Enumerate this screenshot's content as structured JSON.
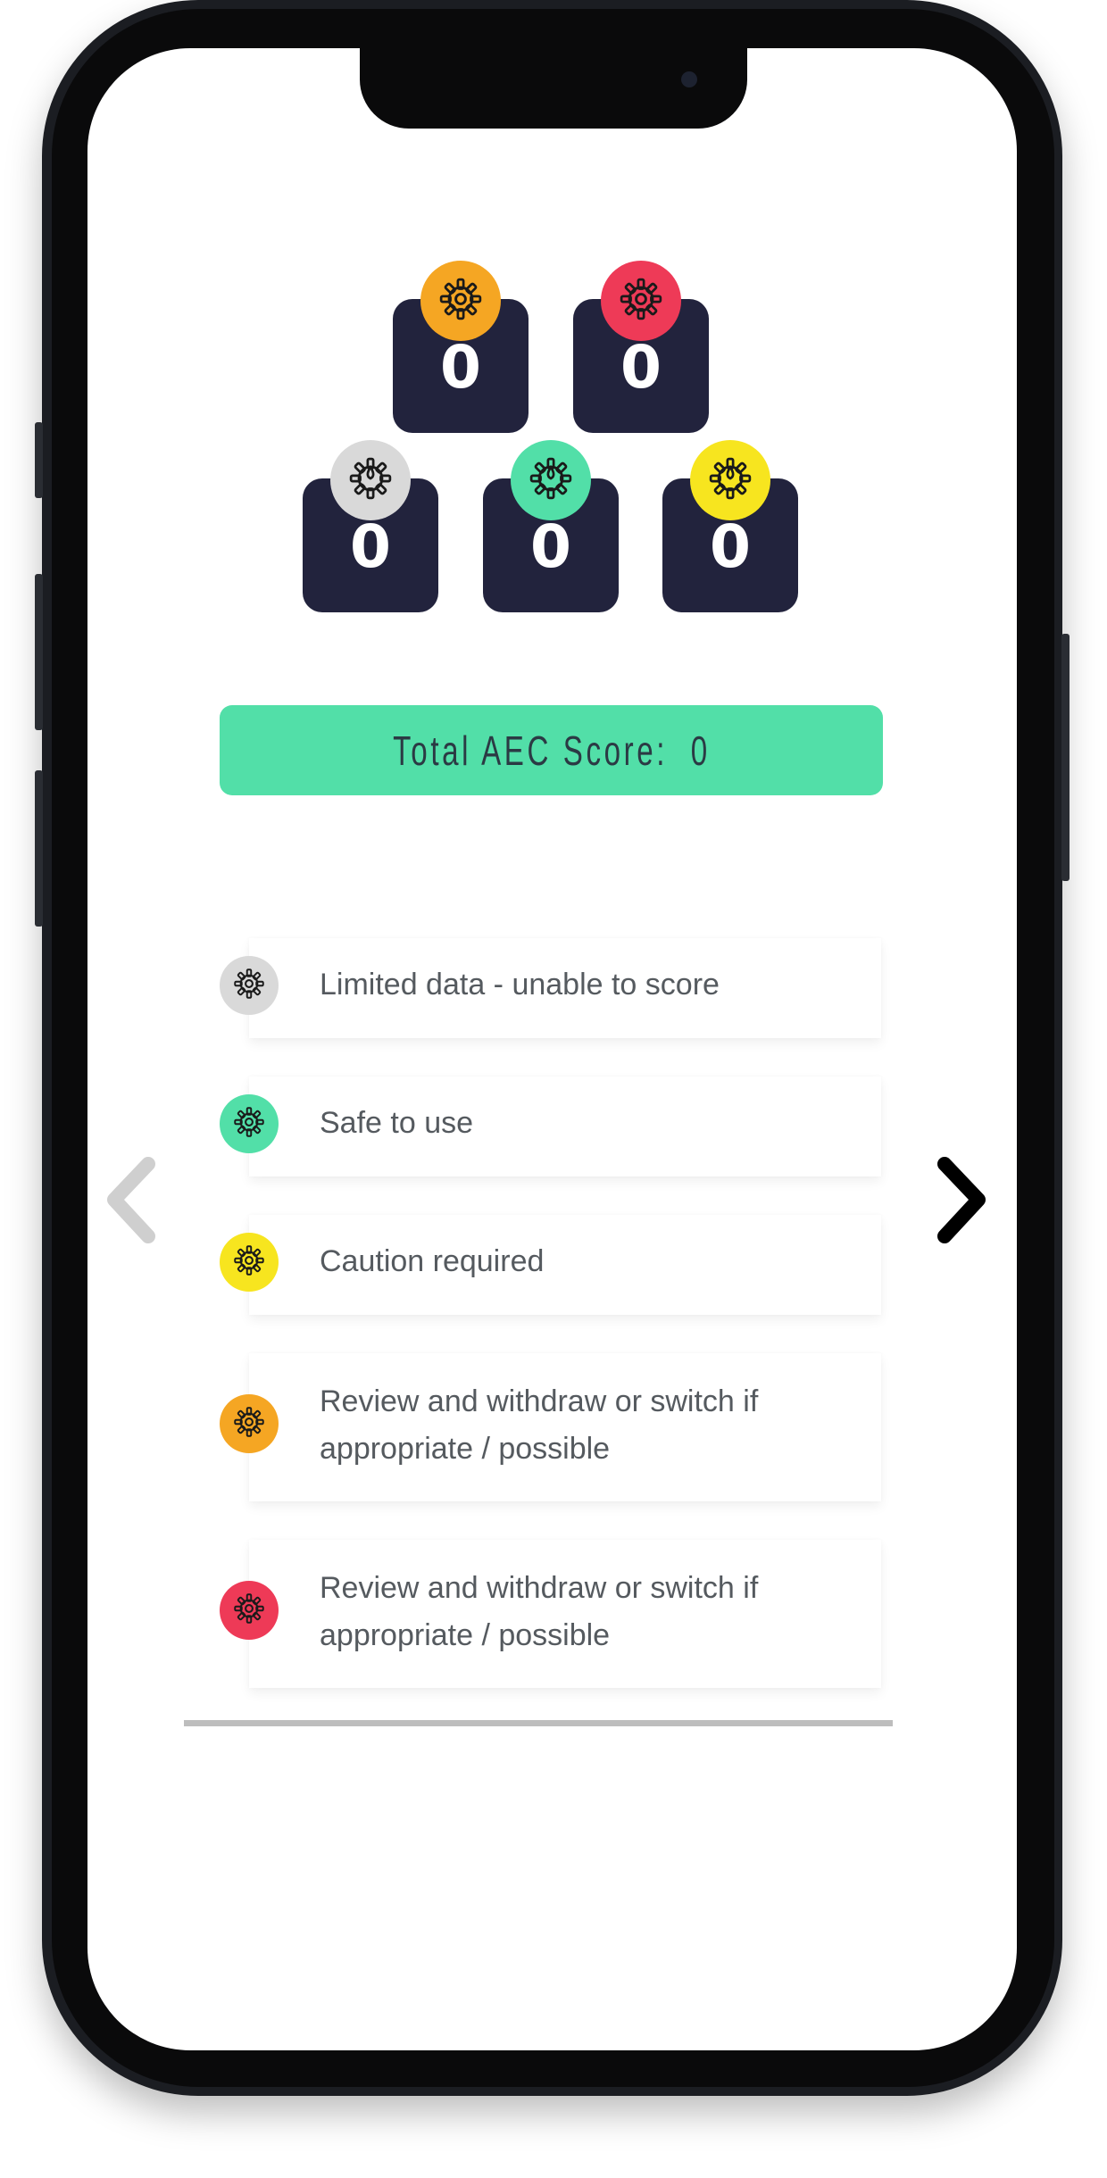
{
  "scores": {
    "top": [
      {
        "value": "0",
        "color": "#f5a623",
        "icon": "gear-icon"
      },
      {
        "value": "0",
        "color": "#ee3a57",
        "icon": "gear-icon"
      }
    ],
    "bottom": [
      {
        "value": "0",
        "color": "#d9d9d9",
        "icon": "gear-drop-icon"
      },
      {
        "value": "0",
        "color": "#52dfa8",
        "icon": "gear-drop-icon"
      },
      {
        "value": "0",
        "color": "#f7e51f",
        "icon": "gear-drop-icon"
      }
    ]
  },
  "total": {
    "label": "Total AEC Score:  0",
    "color": "#52dfa8"
  },
  "legend": [
    {
      "label": "Limited data - unable to score",
      "color": "#d9d9d9"
    },
    {
      "label": "Safe to use",
      "color": "#52dfa8"
    },
    {
      "label": "Caution required",
      "color": "#f7e51f"
    },
    {
      "label": "Review and withdraw or switch if appropriate / possible",
      "color": "#f5a623"
    },
    {
      "label": "Review and withdraw or switch if appropriate / possible",
      "color": "#ee3a57"
    }
  ],
  "nav": {
    "prev_icon": "chevron-left-icon",
    "next_icon": "chevron-right-icon",
    "prev_enabled": false,
    "next_enabled": true
  }
}
